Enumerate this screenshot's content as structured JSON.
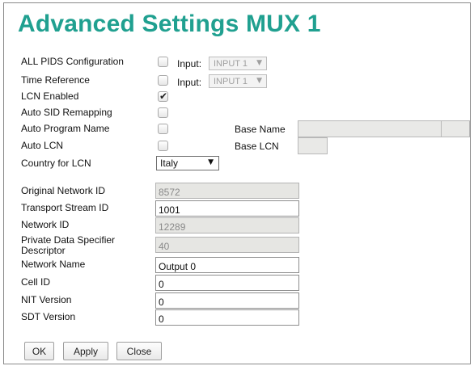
{
  "title": "Advanced Settings MUX 1",
  "rows": {
    "all_pids": {
      "label": "ALL PIDS Configuration",
      "checked": false,
      "input_label": "Input:",
      "input_value": "INPUT 1"
    },
    "time_reference": {
      "label": "Time Reference",
      "checked": false,
      "input_label": "Input:",
      "input_value": "INPUT 1"
    },
    "lcn_enabled": {
      "label": "LCN Enabled",
      "checked": true
    },
    "auto_sid": {
      "label": "Auto SID Remapping",
      "checked": false
    },
    "auto_program_name": {
      "label": "Auto Program Name",
      "checked": false,
      "side_label": "Base Name",
      "side_value": ""
    },
    "auto_lcn": {
      "label": "Auto LCN",
      "checked": false,
      "side_label": "Base LCN",
      "side_value": ""
    },
    "country_for_lcn": {
      "label": "Country for LCN",
      "value": "Italy"
    }
  },
  "fields": {
    "original_network_id": {
      "label": "Original Network ID",
      "value": "8572"
    },
    "transport_stream_id": {
      "label": "Transport Stream ID",
      "value": "1001"
    },
    "network_id": {
      "label": "Network ID",
      "value": "12289"
    },
    "private_data_specifier": {
      "label": "Private Data Specifier Descriptor",
      "value": "40"
    },
    "network_name": {
      "label": "Network Name",
      "value": "Output 0"
    },
    "cell_id": {
      "label": "Cell ID",
      "value": "0"
    },
    "nit_version": {
      "label": "NIT Version",
      "value": "0"
    },
    "sdt_version": {
      "label": "SDT Version",
      "value": "0"
    }
  },
  "buttons": {
    "ok": "OK",
    "apply": "Apply",
    "close": "Close"
  },
  "icons": {
    "dropdown": "chevron-down-icon",
    "check": "checkmark-icon"
  },
  "colors": {
    "title": "#20a090",
    "readonly_bg": "#e6e6e3"
  }
}
